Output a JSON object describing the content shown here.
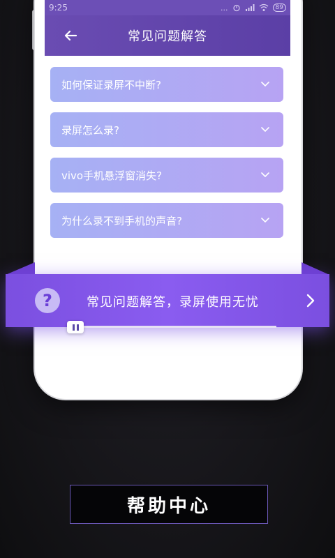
{
  "status_bar": {
    "time": "9:25",
    "signal_text": "...",
    "battery": "89"
  },
  "header": {
    "title": "常见问题解答"
  },
  "faq": [
    {
      "question": "如何保证录屏不中断?"
    },
    {
      "question": "录屏怎么录?"
    },
    {
      "question": "vivo手机悬浮窗消失?"
    },
    {
      "question": "为什么录不到手机的声音?"
    }
  ],
  "banner": {
    "icon": "question-mark-icon",
    "text": "常见问题解答，录屏使用无忧"
  },
  "footer": {
    "label": "帮助中心"
  },
  "colors": {
    "accent": "#6c4fb6",
    "ribbon": "#7b4fe0",
    "card_start": "#a6b1f4",
    "card_end": "#b7a3f3"
  }
}
